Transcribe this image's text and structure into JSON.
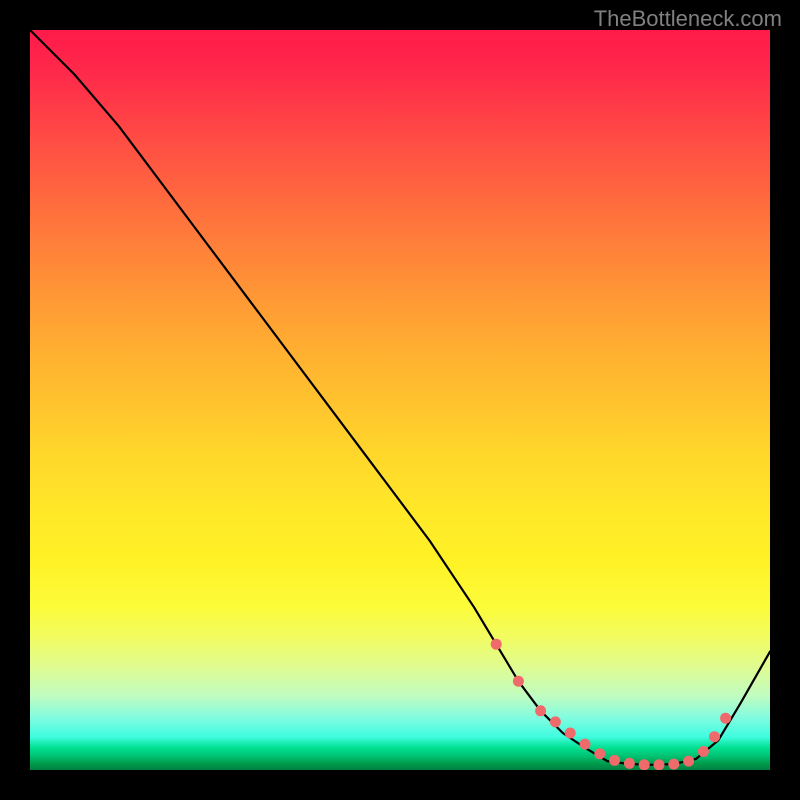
{
  "watermark": "TheBottleneck.com",
  "chart_data": {
    "type": "line",
    "title": "",
    "xlabel": "",
    "ylabel": "",
    "xlim": [
      0,
      100
    ],
    "ylim": [
      0,
      100
    ],
    "series": [
      {
        "name": "curve",
        "x": [
          0,
          6,
          12,
          18,
          24,
          30,
          36,
          42,
          48,
          54,
          60,
          63,
          66,
          69,
          72,
          75,
          78,
          81,
          84,
          87,
          90,
          93,
          96,
          100
        ],
        "y": [
          100,
          94,
          87,
          79,
          71,
          63,
          55,
          47,
          39,
          31,
          22,
          17,
          12,
          8,
          5,
          3,
          1.2,
          0.8,
          0.7,
          0.8,
          1.5,
          4,
          9,
          16
        ]
      }
    ],
    "markers": {
      "name": "highlight-points",
      "x": [
        63,
        66,
        69,
        71,
        73,
        75,
        77,
        79,
        81,
        83,
        85,
        87,
        89,
        91,
        92.5,
        94
      ],
      "y": [
        17,
        12,
        8,
        6.5,
        5,
        3.5,
        2.2,
        1.3,
        0.9,
        0.7,
        0.7,
        0.8,
        1.2,
        2.5,
        4.5,
        7
      ]
    },
    "gradient_stops": [
      {
        "pos": 0,
        "color": "#ff1a4a"
      },
      {
        "pos": 50,
        "color": "#ffc22e"
      },
      {
        "pos": 78,
        "color": "#fcfc3a"
      },
      {
        "pos": 97,
        "color": "#00e090"
      },
      {
        "pos": 100,
        "color": "#008040"
      }
    ]
  }
}
